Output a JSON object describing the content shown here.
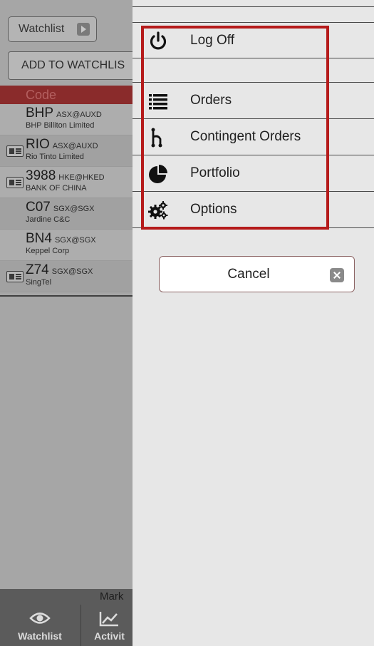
{
  "watchlist": {
    "button_label": "Watchlist",
    "add_button_label": "ADD TO WATCHLIS",
    "column_header": "Code",
    "rows": [
      {
        "code": "BHP",
        "exchange": "ASX@AUXD",
        "name": "BHP Billiton Limited",
        "has_badge": false
      },
      {
        "code": "RIO",
        "exchange": "ASX@AUXD",
        "name": "Rio Tinto Limited",
        "has_badge": true
      },
      {
        "code": "3988",
        "exchange": "HKE@HKED",
        "name": "BANK OF CHINA",
        "has_badge": true
      },
      {
        "code": "C07",
        "exchange": "SGX@SGX",
        "name": "Jardine C&C",
        "has_badge": false
      },
      {
        "code": "BN4",
        "exchange": "SGX@SGX",
        "name": "Keppel Corp",
        "has_badge": false
      },
      {
        "code": "Z74",
        "exchange": "SGX@SGX",
        "name": "SingTel",
        "has_badge": true
      }
    ]
  },
  "footer": {
    "market_text": "Mark",
    "nav": [
      {
        "label": "Watchlist",
        "icon": "eye-icon"
      },
      {
        "label": "Activit",
        "icon": "chart-icon"
      }
    ]
  },
  "menu": {
    "items": [
      {
        "label": "Log Off",
        "icon": "power-icon"
      },
      {
        "label": "Orders",
        "icon": "list-icon"
      },
      {
        "label": "Contingent Orders",
        "icon": "branch-icon"
      },
      {
        "label": "Portfolio",
        "icon": "pie-chart-icon"
      },
      {
        "label": "Options",
        "icon": "gears-icon"
      }
    ],
    "cancel_label": "Cancel"
  },
  "colors": {
    "highlight_box": "#b51b1b",
    "panel_bg": "#e7e7e7",
    "dim_overlay": "#a6a6a6"
  }
}
